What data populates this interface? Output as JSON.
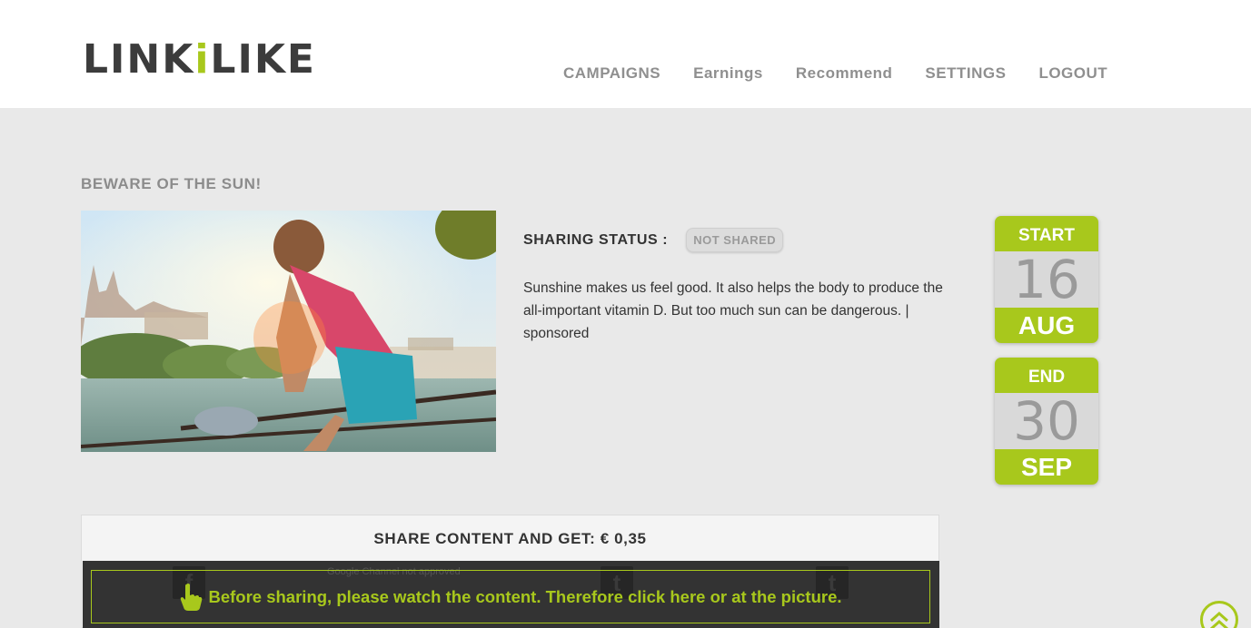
{
  "header": {
    "logo_text_dark_1": "LINK",
    "logo_text_accent": "i",
    "logo_text_dark_2": "LIKE",
    "nav": [
      {
        "label": "CAMPAIGNS"
      },
      {
        "label": "Earnings"
      },
      {
        "label": "Recommend"
      },
      {
        "label": "SETTINGS"
      },
      {
        "label": "LOGOUT"
      }
    ]
  },
  "campaign": {
    "title": "BEWARE OF THE SUN!",
    "image_icon": "campaign-photo-runner",
    "sharing_status_label": "SHARING STATUS :",
    "sharing_status_value": "NOT SHARED",
    "description": "Sunshine makes us feel good. It also helps the body to produce the all-important vitamin D. But too much sun can be dangerous. | sponsored"
  },
  "dates": {
    "start": {
      "label": "START",
      "day": "16",
      "month": "AUG"
    },
    "end": {
      "label": "END",
      "day": "30",
      "month": "SEP"
    }
  },
  "share": {
    "title": "SHARE CONTENT AND GET: € 0,35",
    "google_note": "Google Channel not approved",
    "icons": {
      "facebook": "f",
      "twitter": "t",
      "tumblr": "t"
    },
    "watch_text": "Before sharing, please watch the content. Therefore click here or at the picture.",
    "watch_icon": "pointing-hand-icon"
  },
  "colors": {
    "accent": "#a8c81c",
    "background": "#e9e9e9",
    "text_dark": "#333333",
    "nav_gray": "#8f8f8f"
  },
  "scroll_top_icon": "double-chevron-up-icon"
}
